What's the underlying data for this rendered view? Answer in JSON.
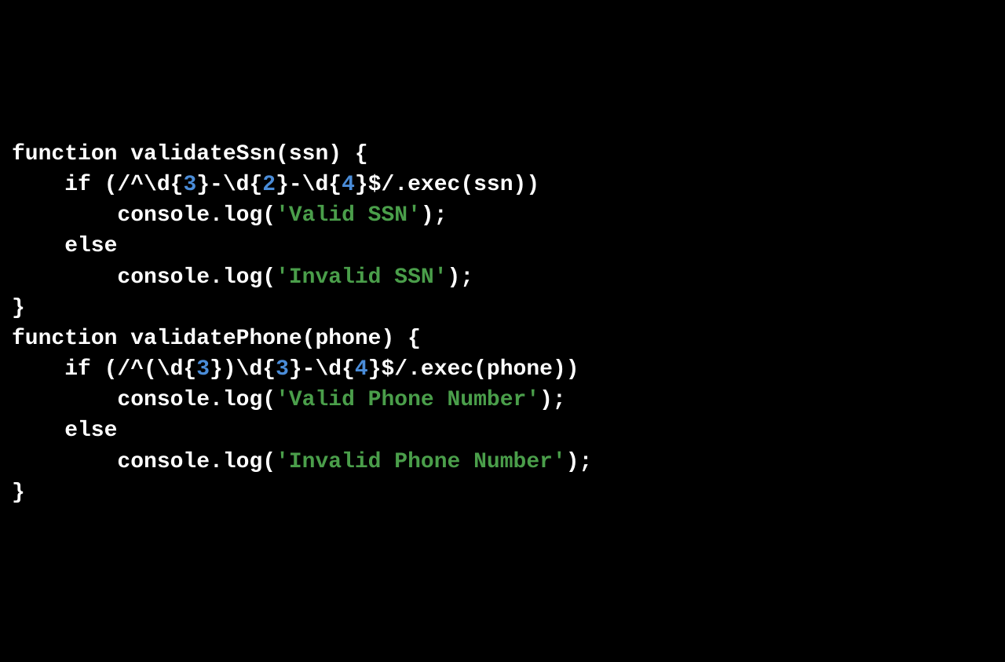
{
  "code": {
    "line1": {
      "p1": "function validateSsn(ssn) {"
    },
    "line2": {
      "p1": "if (/^\\d{",
      "n1": "3",
      "p2": "}-\\d{",
      "n2": "2",
      "p3": "}-\\d{",
      "n3": "4",
      "p4": "}$/.exec(ssn))"
    },
    "line3": {
      "p1": "console.log(",
      "s1": "'Valid SSN'",
      "p2": ");"
    },
    "line4": {
      "p1": "else"
    },
    "line5": {
      "p1": "console.log(",
      "s1": "'Invalid SSN'",
      "p2": ");"
    },
    "line6": {
      "p1": "}"
    },
    "line7": {
      "p1": "function validatePhone(phone) {"
    },
    "line8": {
      "p1": "if (/^(\\d{",
      "n1": "3",
      "p2": "})\\d{",
      "n2": "3",
      "p3": "}-\\d{",
      "n3": "4",
      "p4": "}$/.exec(phone))"
    },
    "line9": {
      "p1": "console.log(",
      "s1": "'Valid Phone Number'",
      "p2": ");"
    },
    "line10": {
      "p1": "else"
    },
    "line11": {
      "p1": "console.log(",
      "s1": "'Invalid Phone Number'",
      "p2": ");"
    },
    "line12": {
      "p1": "}"
    }
  }
}
